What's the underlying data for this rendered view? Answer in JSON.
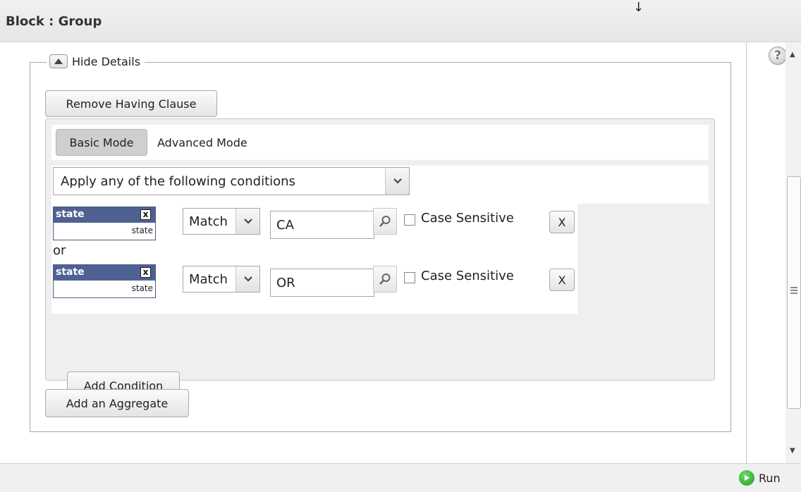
{
  "header": {
    "title": "Block : Group",
    "arrow_glyph": "🡣"
  },
  "details": {
    "toggle_label": "Hide Details",
    "remove_having_label": "Remove Having Clause",
    "basic_mode_label": "Basic Mode",
    "advanced_mode_label": "Advanced Mode",
    "apply_select_value": "Apply any of the following conditions",
    "conditions": [
      {
        "column_name": "state",
        "column_sub": "state",
        "chip_remove_glyph": "x",
        "operator": "Match",
        "value": "CA",
        "case_sensitive_label": "Case Sensitive",
        "remove_label": "X"
      },
      {
        "column_name": "state",
        "column_sub": "state",
        "chip_remove_glyph": "x",
        "operator": "Match",
        "value": "OR",
        "case_sensitive_label": "Case Sensitive",
        "remove_label": "X"
      }
    ],
    "or_label": "or",
    "add_condition_label": "Add Condition",
    "add_aggregate_label": "Add an Aggregate"
  },
  "footer": {
    "run_label": "Run"
  },
  "icons": {
    "help": "help-icon",
    "search": "search-icon",
    "run": "run-icon",
    "toggle": "collapse-up-icon"
  },
  "colors": {
    "chip_header": "#4f6193",
    "run_green": "#1e9a1e"
  }
}
